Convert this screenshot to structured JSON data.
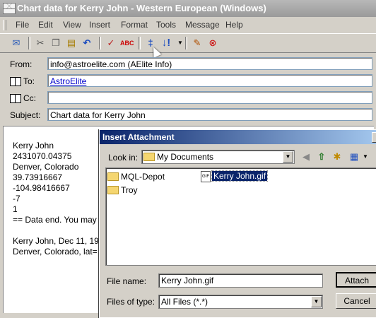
{
  "window": {
    "title": "Chart data for Kerry John - Western European (Windows)"
  },
  "menu": [
    "File",
    "Edit",
    "View",
    "Insert",
    "Format",
    "Tools",
    "Message",
    "Help"
  ],
  "toolbar": {
    "icons": [
      "send-icon",
      "cut-icon",
      "copy-icon",
      "paste-icon",
      "undo-icon",
      "check-names-icon",
      "spelling-icon",
      "attach-icon",
      "priority-icon",
      "dropdown-icon",
      "sign-icon",
      "encrypt-icon"
    ]
  },
  "header": {
    "from_label": "From:",
    "from_value": "info@astroelite.com    (AElite Info)",
    "to_label": "To:",
    "to_value": "AstroElite",
    "cc_label": "Cc:",
    "cc_value": "",
    "subject_label": "Subject:",
    "subject_value": "Chart data for Kerry John"
  },
  "body": {
    "lines": [
      "Kerry John",
      "2431070.04375",
      "Denver, Colorado",
      "39.73916667",
      "-104.98416667",
      "-7",
      "1",
      "== Data end. You may",
      "",
      "Kerry John, Dec 11, 19",
      "Denver, Colorado, lat="
    ]
  },
  "dialog": {
    "title": "Insert Attachment",
    "look_in_label": "Look in:",
    "look_in_value": "My Documents",
    "folders": [
      "MQL-Depot",
      "Troy"
    ],
    "file": "Kerry John.gif",
    "file_icon_text": "GIF",
    "file_name_label": "File name:",
    "file_name_value": "Kerry John.gif",
    "files_of_type_label": "Files of type:",
    "files_of_type_value": "All Files (*.*)",
    "attach_label": "Attach",
    "cancel_label": "Cancel"
  }
}
